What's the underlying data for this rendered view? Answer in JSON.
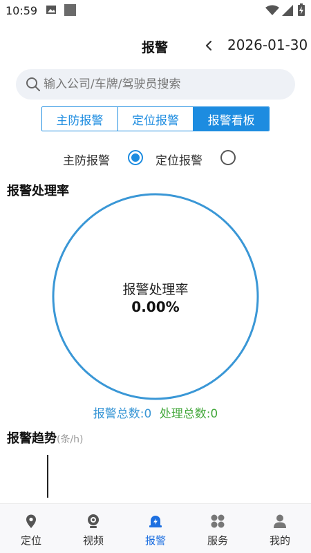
{
  "status_bar": {
    "time": "10:59"
  },
  "header": {
    "title": "报警",
    "date": "2026-01-30"
  },
  "search": {
    "placeholder": "输入公司/车牌/驾驶员搜索",
    "value": ""
  },
  "tabs": [
    {
      "label": "主防报警",
      "active": false
    },
    {
      "label": "定位报警",
      "active": false
    },
    {
      "label": "报警看板",
      "active": true
    }
  ],
  "radio_options": [
    {
      "label": "主防报警",
      "selected": true
    },
    {
      "label": "定位报警",
      "selected": false
    }
  ],
  "rate_section": {
    "title": "报警处理率",
    "center_label": "报警处理率",
    "center_value": "0.00%",
    "total_alarm": "报警总数:0",
    "total_handled": "处理总数:0"
  },
  "trend_section": {
    "title": "报警趋势",
    "unit": "(条/h)"
  },
  "bottom_nav": [
    {
      "label": "定位",
      "icon": "location-pin-icon"
    },
    {
      "label": "视频",
      "icon": "camera-icon"
    },
    {
      "label": "报警",
      "icon": "alarm-bell-icon"
    },
    {
      "label": "服务",
      "icon": "grid-icon"
    },
    {
      "label": "我的",
      "icon": "user-icon"
    }
  ],
  "colors": {
    "accent": "#1d8ce0",
    "chart_ring": "#3a97d6",
    "handled": "#44a83c",
    "active_nav": "#1d6fe0"
  },
  "chart_data": {
    "type": "pie",
    "center_label": "报警处理率",
    "center_value": "0.00%",
    "values": [
      0,
      0
    ],
    "categories": [
      "报警总数",
      "处理总数"
    ]
  }
}
